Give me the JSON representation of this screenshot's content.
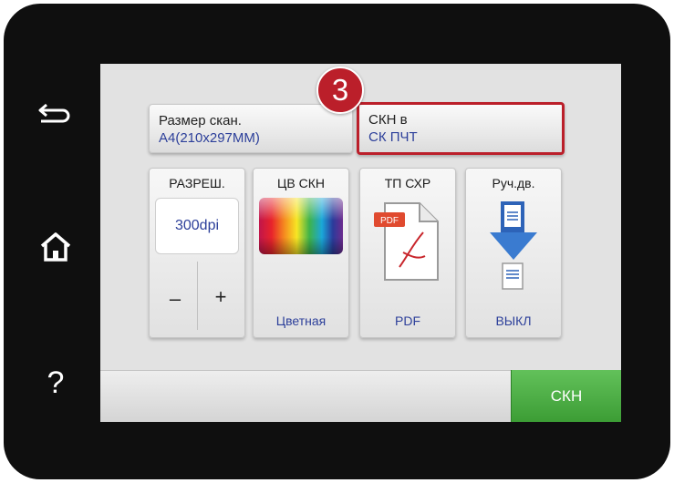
{
  "side_buttons": {
    "back": "back-arrow-icon",
    "home": "home-icon",
    "help_label": "?"
  },
  "scan_size": {
    "label": "Размер скан.",
    "value": "A4(210x297MM)"
  },
  "scan_to": {
    "label": "СКН в",
    "value": "СК ПЧТ"
  },
  "callout_number": "3",
  "resolution": {
    "title": "РАЗРЕШ.",
    "value": "300dpi",
    "minus": "–",
    "plus": "+"
  },
  "color": {
    "title": "ЦВ СКН",
    "value": "Цветная"
  },
  "file_type": {
    "title": "ТП СХР",
    "value": "PDF",
    "badge": "PDF"
  },
  "duplex": {
    "title": "Руч.дв.",
    "value": "ВЫКЛ"
  },
  "scan_button": "СКН",
  "colors": {
    "accent_red": "#bb1f2a",
    "scan_green": "#4caf45",
    "value_blue": "#2c3f9a"
  }
}
